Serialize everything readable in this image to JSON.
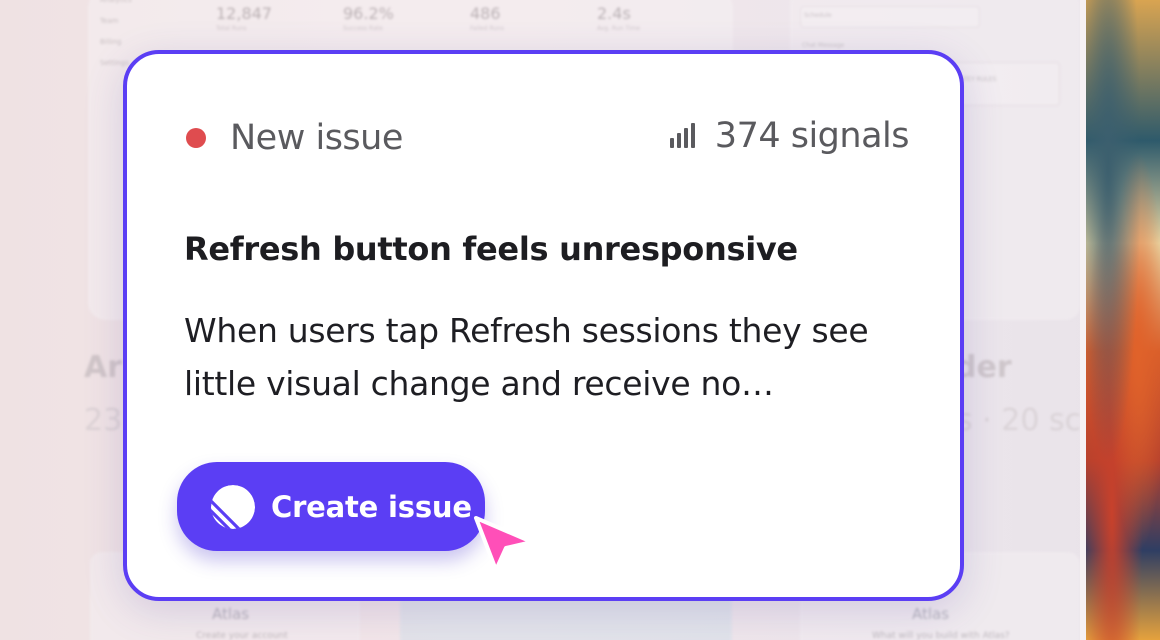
{
  "background": {
    "nav_items": [
      "Analytics",
      "Team",
      "Billing",
      "Settings"
    ],
    "stats": [
      {
        "value": "12,847",
        "label": "Total Runs"
      },
      {
        "value": "96.2%",
        "label": "Success Rate"
      },
      {
        "value": "486",
        "label": "Failed Runs"
      },
      {
        "value": "2.4s",
        "label": "Avg. Run Time"
      }
    ],
    "right_panel": {
      "schedule_label": "Schedule",
      "chat_label": "Chat Message",
      "rules_label": "ATEY RULES"
    },
    "left_title": "Ar",
    "left_number": "23",
    "right_title": "der",
    "right_number": "s · 20 sc",
    "bottom_left": {
      "logo": "Atlas",
      "subtitle": "Create your account"
    },
    "bottom_right": {
      "logo": "Atlas",
      "subtitle": "What will you build with Atlas?"
    }
  },
  "card": {
    "status_label": "New issue",
    "status_color": "#df4c4f",
    "signal_icon": "signal-bars-icon",
    "signals_label": "374 signals",
    "title": "Refresh button feels unresponsive",
    "description": "When users tap Refresh sessions they see little visual change and receive no…",
    "button_label": "Create issue",
    "button_icon": "linear-logo-icon",
    "accent_color": "#5b3ef4",
    "cursor_color": "#ff4fb8"
  }
}
